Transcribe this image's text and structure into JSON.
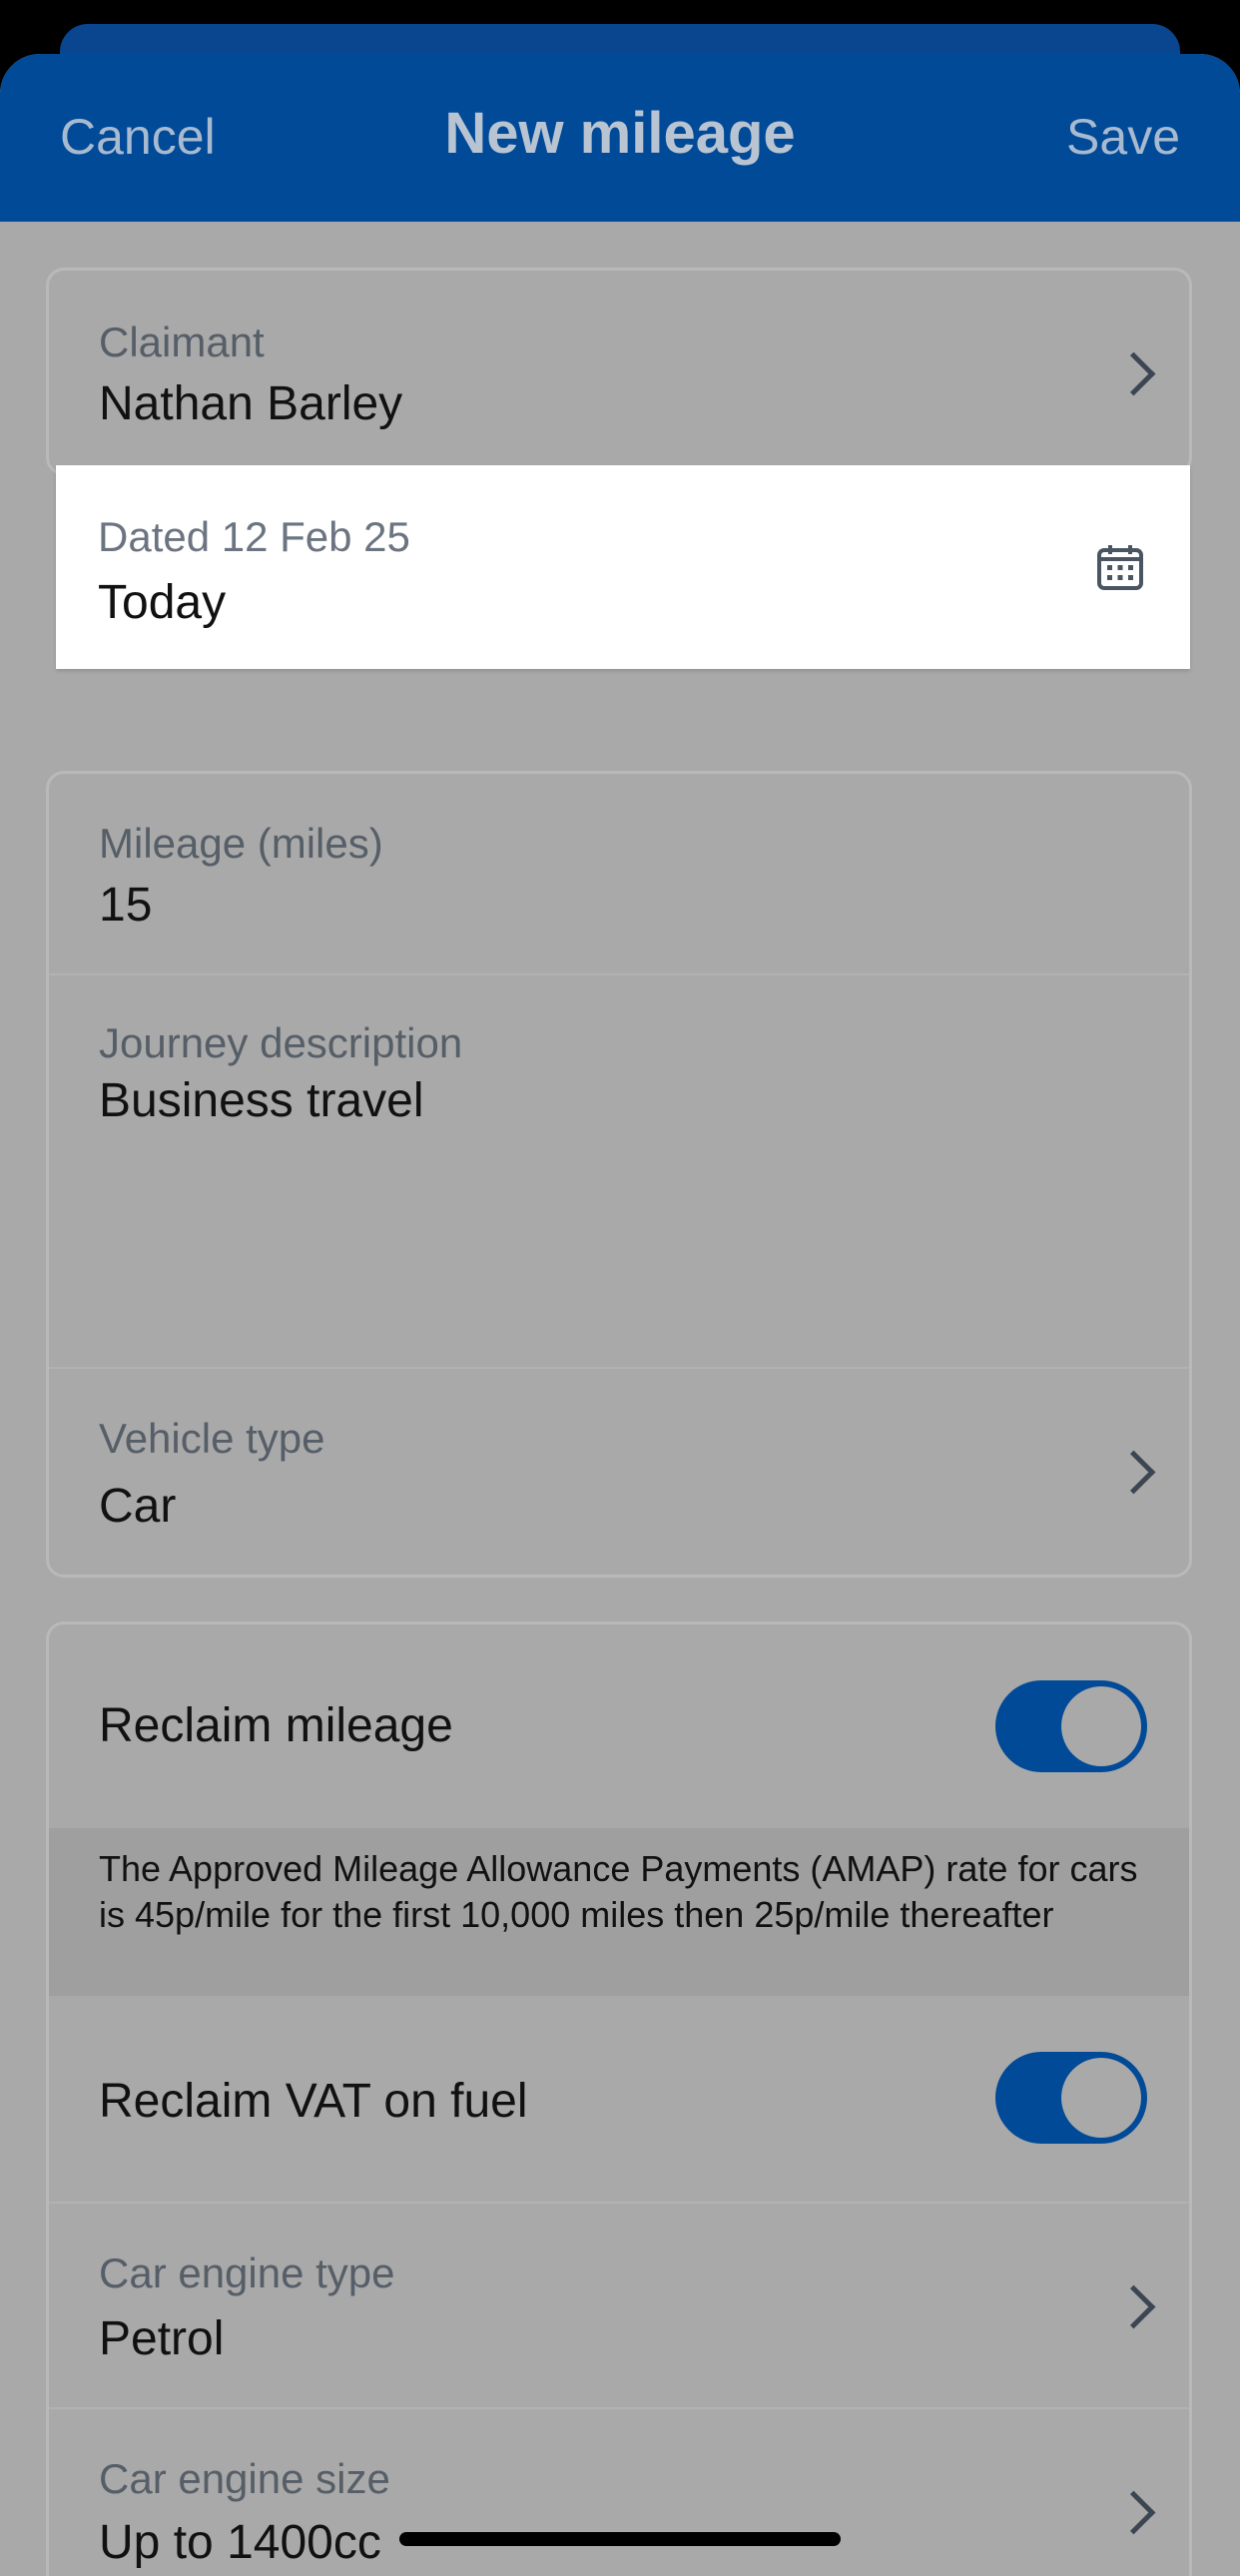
{
  "nav": {
    "cancel": "Cancel",
    "title": "New mileage",
    "save": "Save"
  },
  "claimant": {
    "label": "Claimant",
    "value": "Nathan Barley"
  },
  "date": {
    "label": "Dated 12 Feb 25",
    "value": "Today"
  },
  "mileage": {
    "label": "Mileage (miles)",
    "value": "15"
  },
  "journey": {
    "label": "Journey description",
    "value": "Business travel"
  },
  "vehicle": {
    "label": "Vehicle type",
    "value": "Car"
  },
  "reclaim_mileage": {
    "label": "Reclaim mileage",
    "on": true
  },
  "amap_info": "The Approved Mileage Allowance Payments (AMAP) rate for cars is 45p/mile for the first 10,000 miles then 25p/mile thereafter",
  "reclaim_vat": {
    "label": "Reclaim VAT on fuel",
    "on": true
  },
  "engine_type": {
    "label": "Car engine type",
    "value": "Petrol"
  },
  "engine_size": {
    "label": "Car engine size",
    "value": "Up to 1400cc"
  },
  "colors": {
    "brand": "#004a98",
    "overlay_bg": "#a9a9a9"
  }
}
